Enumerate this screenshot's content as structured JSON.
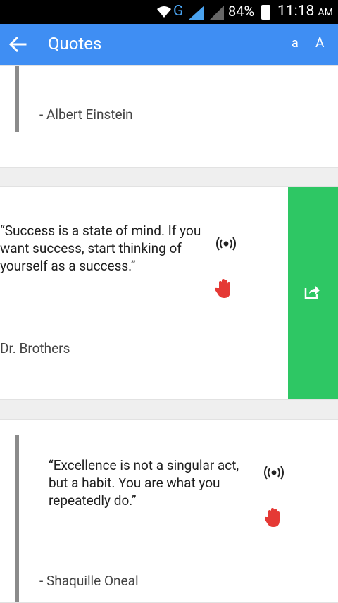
{
  "status_bar": {
    "network": "G",
    "battery_percent": "84%",
    "time": "11:18",
    "ampm": "AM"
  },
  "appbar": {
    "title": "Quotes",
    "font_small_label": "a",
    "font_large_label": "A"
  },
  "quotes": [
    {
      "text": "",
      "author": "- Albert Einstein"
    },
    {
      "text": "“Success is a state of mind. If you want success, start thinking of yourself as a success.”",
      "author": "Dr. Brothers"
    },
    {
      "text": "“Excellence is not a singular act, but a habit. You are what you repeatedly do.”",
      "author": "- Shaquille Oneal"
    }
  ],
  "icons": {
    "back": "arrow-left-icon",
    "listen": "broadcast-icon",
    "stop": "hand-icon",
    "share": "share-icon"
  },
  "colors": {
    "appbar": "#3f8ef3",
    "share_panel": "#2ec764",
    "hand": "#e53935"
  }
}
